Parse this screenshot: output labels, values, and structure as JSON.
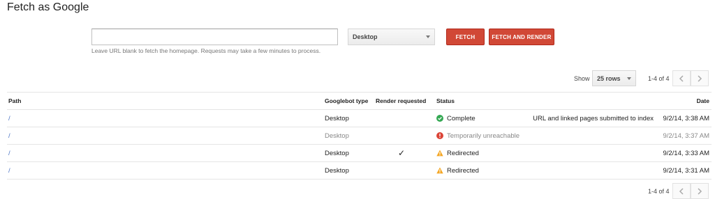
{
  "page": {
    "title": "Fetch as Google"
  },
  "fetch_form": {
    "url_value": "",
    "url_placeholder": "",
    "hint": "Leave URL blank to fetch the homepage. Requests may take a few minutes to process.",
    "crawler_select": "Desktop",
    "fetch_label": "FETCH",
    "fetch_render_label": "FETCH AND RENDER"
  },
  "pager_top": {
    "show_label": "Show",
    "rows_select": "25 rows",
    "count": "1-4 of 4"
  },
  "pager_bottom": {
    "count": "1-4 of 4"
  },
  "table": {
    "columns": {
      "path": "Path",
      "googlebot_type": "Googlebot type",
      "render_requested": "Render requested",
      "status": "Status",
      "date": "Date"
    },
    "rows": [
      {
        "path": "/",
        "googlebot_type": "Desktop",
        "render_requested": "",
        "status": "Complete",
        "status_icon": "check-circle-icon",
        "status_color": "#34a853",
        "detail": "URL and linked pages submitted to index",
        "date": "9/2/14, 3:38 AM",
        "muted": false
      },
      {
        "path": "/",
        "googlebot_type": "Desktop",
        "render_requested": "",
        "status": "Temporarily unreachable",
        "status_icon": "error-circle-icon",
        "status_color": "#db4437",
        "detail": "",
        "date": "9/2/14, 3:37 AM",
        "muted": true
      },
      {
        "path": "/",
        "googlebot_type": "Desktop",
        "render_requested": "✓",
        "status": "Redirected",
        "status_icon": "warning-triangle-icon",
        "status_color": "#f4a623",
        "detail": "",
        "date": "9/2/14, 3:33 AM",
        "muted": false
      },
      {
        "path": "/",
        "googlebot_type": "Desktop",
        "render_requested": "",
        "status": "Redirected",
        "status_icon": "warning-triangle-icon",
        "status_color": "#f4a623",
        "detail": "",
        "date": "9/2/14, 3:31 AM",
        "muted": false
      }
    ]
  },
  "colors": {
    "accent_red": "#d14836",
    "link_blue": "#4a73c4"
  }
}
